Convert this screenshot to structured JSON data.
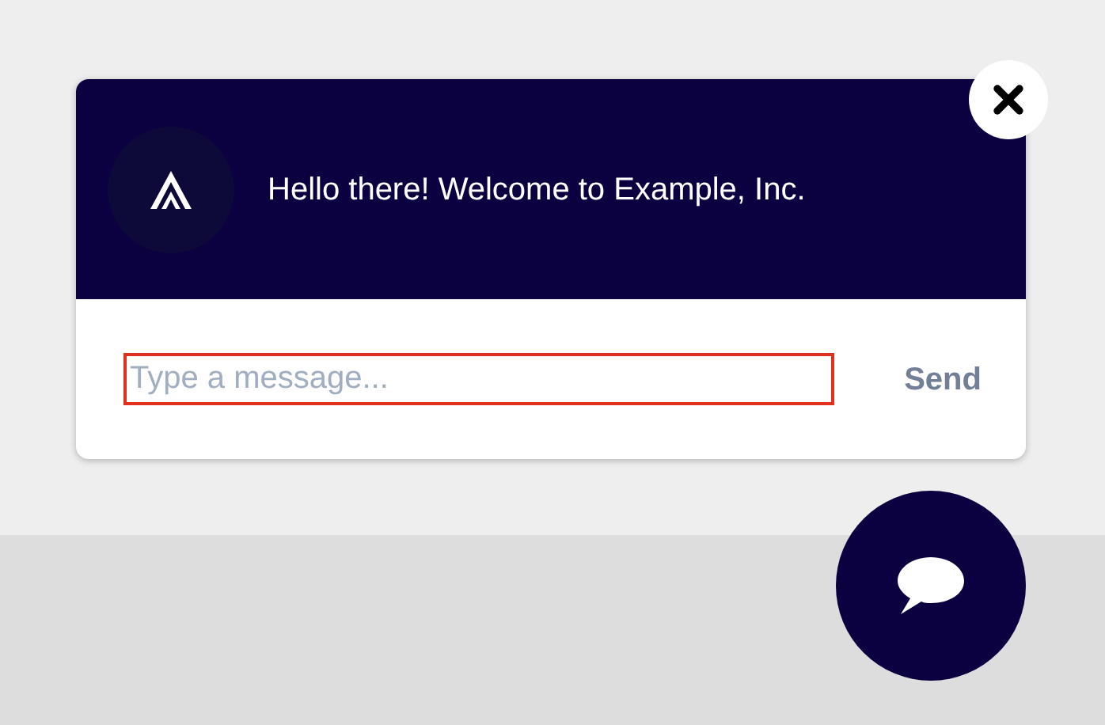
{
  "chat_popup": {
    "greeting": "Hello there! Welcome to Example, Inc.",
    "message_field": {
      "placeholder": "Type a message..."
    },
    "send_button": "Send"
  }
}
